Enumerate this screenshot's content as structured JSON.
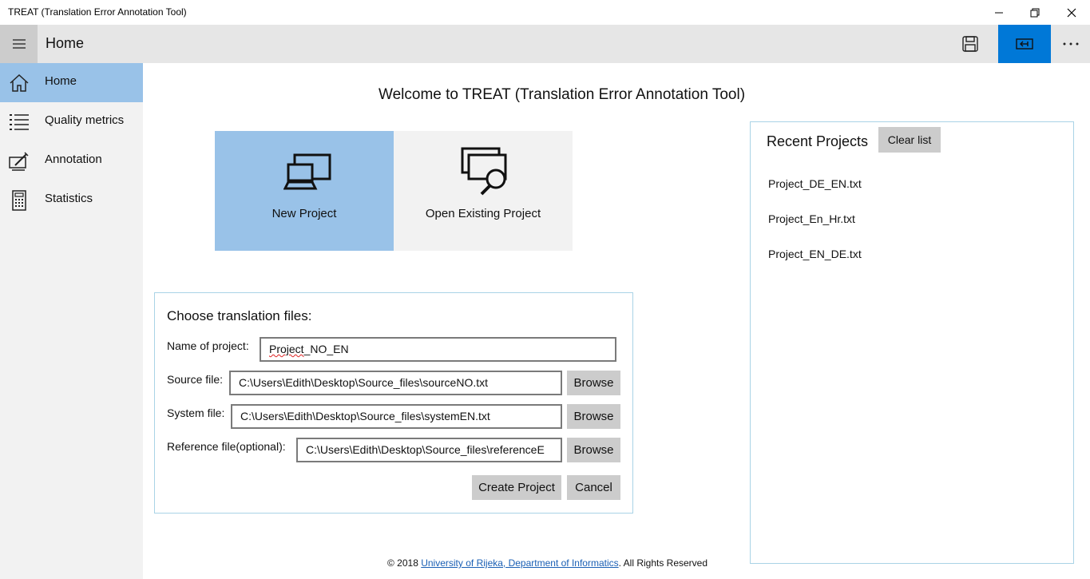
{
  "window": {
    "title": "TREAT (Translation Error Annotation Tool)"
  },
  "appbar": {
    "page_title": "Home"
  },
  "sidebar": {
    "items": [
      {
        "label": "Home",
        "icon": "home-icon",
        "active": true
      },
      {
        "label": "Quality metrics",
        "icon": "list-icon",
        "active": false
      },
      {
        "label": "Annotation",
        "icon": "annotation-icon",
        "active": false
      },
      {
        "label": "Statistics",
        "icon": "calculator-icon",
        "active": false
      }
    ]
  },
  "main": {
    "welcome": "Welcome to TREAT (Translation Error Annotation Tool)",
    "tiles": [
      {
        "label": "New Project",
        "icon": "new-project-icon",
        "selected": true
      },
      {
        "label": "Open Existing Project",
        "icon": "open-project-icon",
        "selected": false
      }
    ],
    "form": {
      "title": "Choose translation files:",
      "name_label": "Name of project:",
      "name_value_part1": "Project",
      "name_value_part2": "_NO_EN",
      "source_label": "Source file:",
      "source_value": "C:\\Users\\Edith\\Desktop\\Source_files\\sourceNO.txt",
      "system_label": "System file:",
      "system_value": "C:\\Users\\Edith\\Desktop\\Source_files\\systemEN.txt",
      "reference_label": "Reference file(optional):",
      "reference_value": "C:\\Users\\Edith\\Desktop\\Source_files\\referenceE",
      "browse_label": "Browse",
      "create_label": "Create Project",
      "cancel_label": "Cancel"
    }
  },
  "recent": {
    "title": "Recent Projects",
    "clear_label": "Clear list",
    "items": [
      "Project_DE_EN.txt",
      "Project_En_Hr.txt",
      "Project_EN_DE.txt"
    ]
  },
  "footer": {
    "prefix": "© 2018 ",
    "link": "University of Rijeka, Department of Informatics",
    "suffix": ". All Rights Reserved"
  },
  "colors": {
    "accent": "#0078d7",
    "selected": "#99c2e8",
    "panel_border": "#a9d3e6",
    "appbar": "#e6e6e6",
    "sidebar": "#f2f2f2"
  }
}
